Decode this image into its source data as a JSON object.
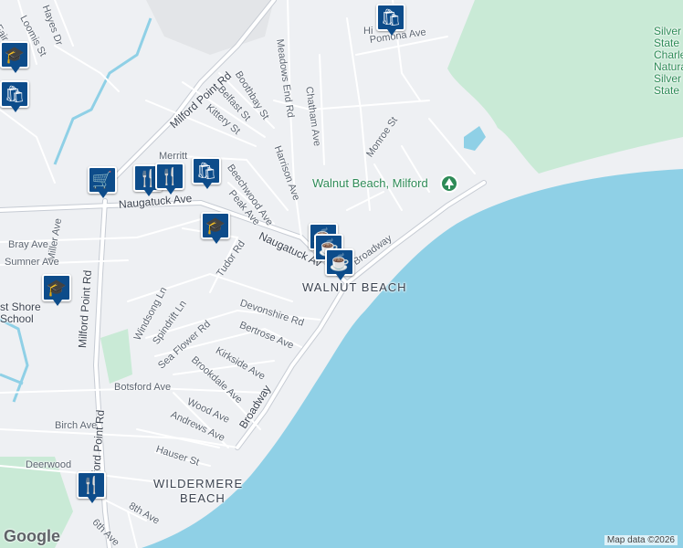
{
  "map": {
    "colors": {
      "land": "#eef0f3",
      "water": "#8fd0e6",
      "park": "#c9ead6",
      "road": "#ffffff",
      "road_edge": "#c6cbd3",
      "pin": "#0d4c8a"
    },
    "area_labels": [
      "WALNUT BEACH",
      "WILDERMERE",
      "BEACH"
    ],
    "poi_label": "Walnut Beach, Milford",
    "park_label": "Silver Sands State Park / Charles Island Natural Area / Silver Sands State Park",
    "park_label_lines": "Silver\nState\nCharle\nNatura\nSilver\nState",
    "school_label": "East Shore School",
    "school_label_lines": "st Shore\nSchool",
    "streets": {
      "meadows_end": "Meadows End Rd",
      "hayes": "Hayes Dr",
      "loomis": "Loomis St",
      "fair": "Fair",
      "milford_point_top": "Milford Point Rd",
      "boothbay": "Boothbay St",
      "belfast": "Belfast St",
      "kittery": "Kittery St",
      "chatham": "Chatham Ave",
      "harrison": "Harrison Ave",
      "monroe": "Monroe St",
      "pomona": "Pomona Ave",
      "hi": "Hi",
      "merritt": "Merritt",
      "beechwood": "Beechwood Ave",
      "peak": "Peak Ave",
      "naugatuck_w": "Naugatuck Ave",
      "naugatuck_e": "Naugatuck Av",
      "broadway_top": "Broadway",
      "broadway": "Broadway",
      "miller": "Miller Ave",
      "bray": "Bray Ave",
      "sumner": "Sumner Ave",
      "milford_point_w": "Milford Point Rd",
      "tudor": "Tudor Rd",
      "windsong": "Windsong Ln",
      "spindrift": "Spindrift Ln",
      "sea_flower": "Sea Flower Rd",
      "devonshire": "Devonshire Rd",
      "bertrose": "Bertrose Ave",
      "kirkside": "Kirkside Ave",
      "brookdale": "Brookdale Ave",
      "botsford": "Botsford Ave",
      "wood": "Wood Ave",
      "andrews": "Andrews Ave",
      "birch": "Birch Ave",
      "hauser": "Hauser St",
      "deerwood": "Deerwood",
      "eighth": "8th Ave",
      "sixth": "6th Ave",
      "milford_point_s": "Milford Point Rd"
    },
    "markers": [
      {
        "type": "school",
        "icon": "graduation-cap-icon",
        "glyph": "🎓"
      },
      {
        "type": "shopping",
        "icon": "shopping-bag-icon",
        "glyph": "🛍"
      },
      {
        "type": "shopping-cart",
        "icon": "shopping-cart-icon",
        "glyph": "🛒"
      },
      {
        "type": "restaurant",
        "icon": "fork-knife-icon",
        "glyph": "🍴"
      },
      {
        "type": "restaurant",
        "icon": "fork-knife-icon",
        "glyph": "🍴"
      },
      {
        "type": "shopping",
        "icon": "shopping-bag-icon",
        "glyph": "🛍"
      },
      {
        "type": "school",
        "icon": "graduation-cap-icon",
        "glyph": "🎓"
      },
      {
        "type": "cafe",
        "icon": "coffee-cup-icon",
        "glyph": "☕"
      },
      {
        "type": "shopping",
        "icon": "shopping-bag-icon",
        "glyph": "🛍"
      },
      {
        "type": "school",
        "icon": "graduation-cap-icon",
        "glyph": "🎓"
      },
      {
        "type": "restaurant",
        "icon": "fork-knife-icon",
        "glyph": "🍴"
      }
    ],
    "attribution": "Map data ©2026",
    "logo": "Google"
  }
}
